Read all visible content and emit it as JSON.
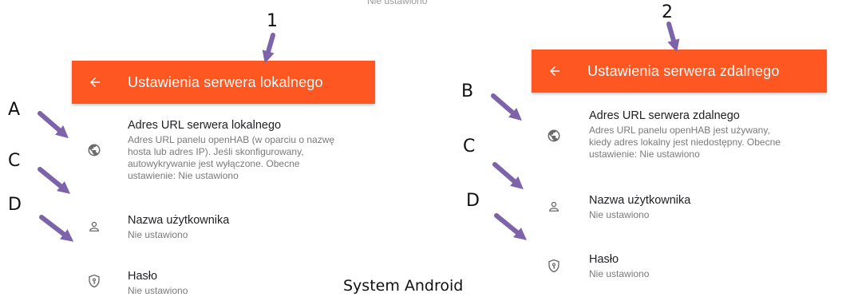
{
  "background_status": "Nie ustawiono",
  "caption": "System Android",
  "accent_color": "#fe5722",
  "annotation_color": "#7d64aa",
  "markers": {
    "one": "1",
    "two": "2",
    "a": "A",
    "b": "B",
    "c_left": "C",
    "c_right": "C",
    "d_left": "D",
    "d_right": "D"
  },
  "local_screen": {
    "title": "Ustawienia serwera lokalnego",
    "back_icon": "arrow-left-icon",
    "items": [
      {
        "icon": "globe-icon",
        "title": "Adres URL serwera lokalnego",
        "summary_lines": [
          "Adres URL panelu openHAB (w oparciu o nazwę",
          "hosta lub adres IP). Jeśli skonfigurowany,",
          "autowykrywanie jest wyłączone. Obecne",
          "ustawienie: Nie ustawiono"
        ]
      },
      {
        "icon": "person-icon",
        "title": "Nazwa użytkownika",
        "summary_lines": [
          "Nie ustawiono"
        ]
      },
      {
        "icon": "shield-key-icon",
        "title": "Hasło",
        "summary_lines": [
          "Nie ustawiono"
        ]
      }
    ]
  },
  "remote_screen": {
    "title": "Ustawienia serwera zdalnego",
    "back_icon": "arrow-left-icon",
    "items": [
      {
        "icon": "globe-icon",
        "title": "Adres URL serwera zdalnego",
        "summary_lines": [
          "Adres URL panelu openHAB jest używany,",
          "kiedy adres lokalny jest niedostępny. Obecne",
          "ustawienie: Nie ustawiono"
        ]
      },
      {
        "icon": "person-icon",
        "title": "Nazwa użytkownika",
        "summary_lines": [
          "Nie ustawiono"
        ]
      },
      {
        "icon": "shield-key-icon",
        "title": "Hasło",
        "summary_lines": [
          "Nie ustawiono"
        ]
      }
    ]
  }
}
